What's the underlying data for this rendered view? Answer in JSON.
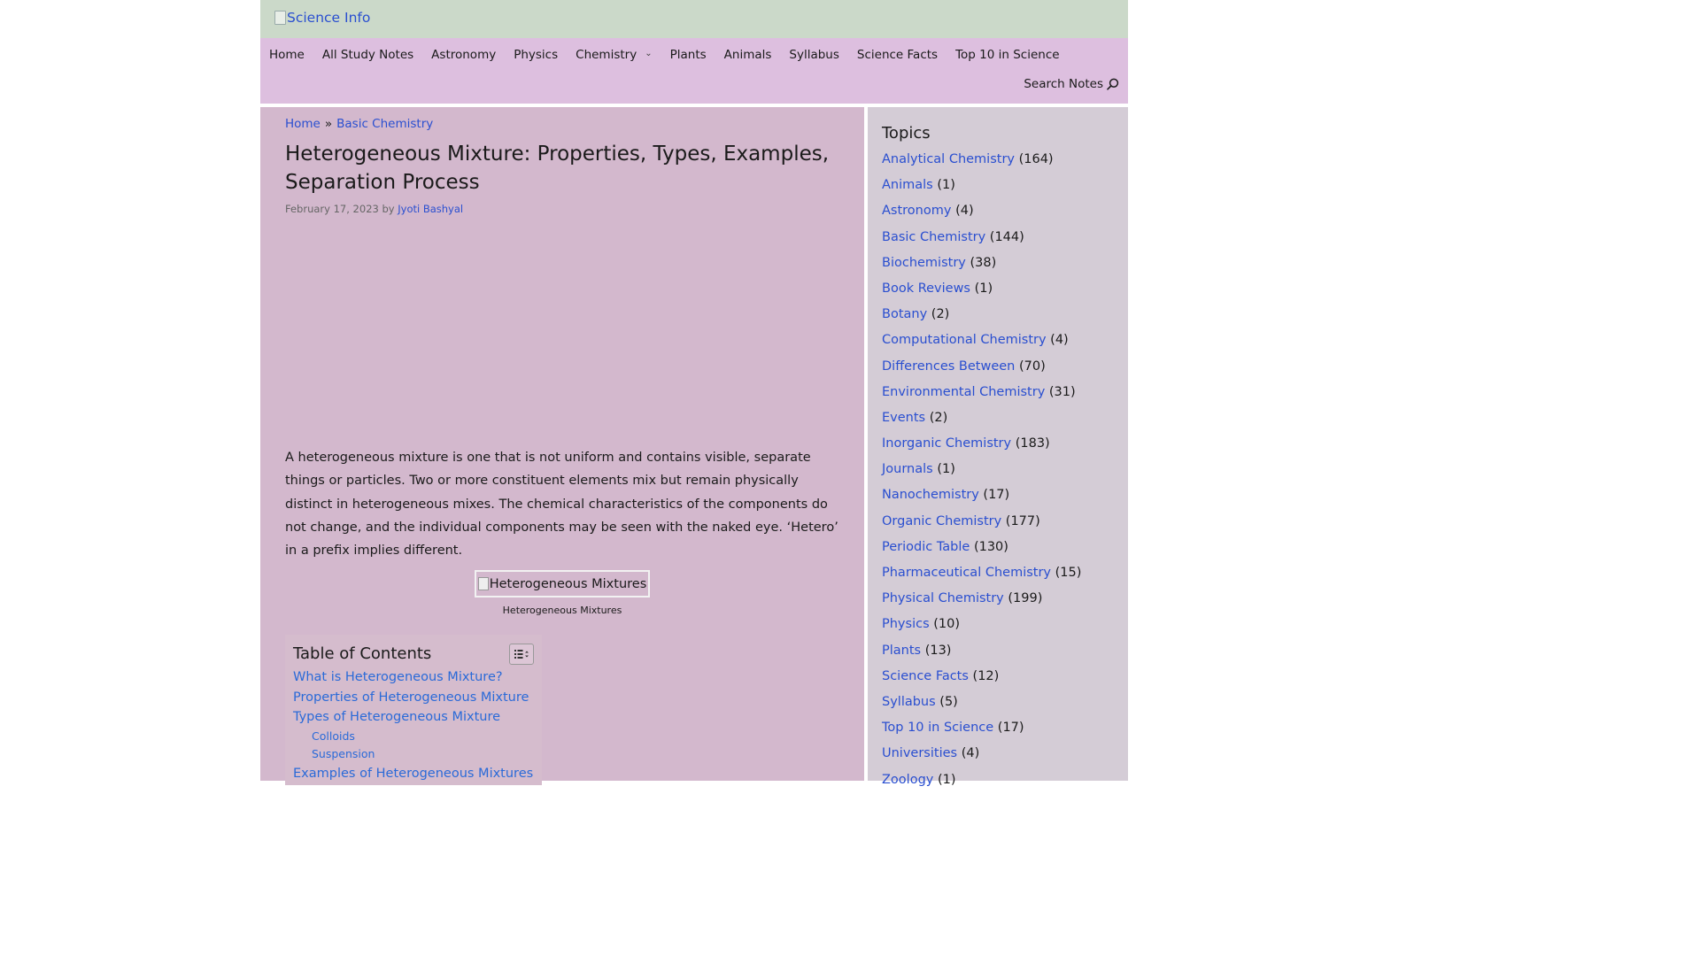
{
  "site": {
    "logo_text": "Science Info"
  },
  "nav": {
    "items": [
      "Home",
      "All Study Notes",
      "Astronomy",
      "Physics",
      "Chemistry",
      "Plants",
      "Animals",
      "Syllabus",
      "Science Facts",
      "Top 10 in Science"
    ],
    "search_label": "Search Notes"
  },
  "breadcrumb": {
    "home": "Home",
    "separator": "»",
    "category": "Basic Chemistry"
  },
  "article": {
    "title": "Heterogeneous Mixture: Properties, Types, Examples, Separation Process",
    "date": "February 17, 2023",
    "by": "by",
    "author": "Jyoti Bashyal",
    "intro": "A heterogeneous mixture is one that is not uniform and contains visible, separate things or particles. Two or more constituent elements mix but remain physically distinct in heterogeneous mixes. The chemical characteristics of the components do not change, and the individual components may be seen with the naked eye. ‘Hetero’ in a prefix implies different.",
    "figure_alt": "Heterogeneous Mixtures",
    "figure_caption": "Heterogeneous Mixtures"
  },
  "toc": {
    "title": "Table of Contents",
    "items": [
      {
        "label": "What is Heterogeneous Mixture?",
        "level": 1
      },
      {
        "label": "Properties of Heterogeneous Mixture",
        "level": 1
      },
      {
        "label": "Types of Heterogeneous Mixture",
        "level": 1
      },
      {
        "label": "Colloids",
        "level": 2
      },
      {
        "label": "Suspension",
        "level": 2
      },
      {
        "label": "Examples of Heterogeneous Mixtures",
        "level": 1
      }
    ]
  },
  "sidebar": {
    "title": "Topics",
    "topics": [
      {
        "name": "Analytical Chemistry",
        "count": "(164)"
      },
      {
        "name": "Animals",
        "count": "(1)"
      },
      {
        "name": "Astronomy",
        "count": "(4)"
      },
      {
        "name": "Basic Chemistry",
        "count": "(144)"
      },
      {
        "name": "Biochemistry",
        "count": "(38)"
      },
      {
        "name": "Book Reviews",
        "count": "(1)"
      },
      {
        "name": "Botany",
        "count": "(2)"
      },
      {
        "name": "Computational Chemistry",
        "count": "(4)"
      },
      {
        "name": "Differences Between",
        "count": "(70)"
      },
      {
        "name": "Environmental Chemistry",
        "count": "(31)"
      },
      {
        "name": "Events",
        "count": "(2)"
      },
      {
        "name": "Inorganic Chemistry",
        "count": "(183)"
      },
      {
        "name": "Journals",
        "count": "(1)"
      },
      {
        "name": "Nanochemistry",
        "count": "(17)"
      },
      {
        "name": "Organic Chemistry",
        "count": "(177)"
      },
      {
        "name": "Periodic Table",
        "count": "(130)"
      },
      {
        "name": "Pharmaceutical Chemistry",
        "count": "(15)"
      },
      {
        "name": "Physical Chemistry",
        "count": "(199)"
      },
      {
        "name": "Physics",
        "count": "(10)"
      },
      {
        "name": "Plants",
        "count": "(13)"
      },
      {
        "name": "Science Facts",
        "count": "(12)"
      },
      {
        "name": "Syllabus",
        "count": "(5)"
      },
      {
        "name": "Top 10 in Science",
        "count": "(17)"
      },
      {
        "name": "Universities",
        "count": "(4)"
      },
      {
        "name": "Zoology",
        "count": "(1)"
      }
    ]
  },
  "colors": {
    "header_bg": "#cbd9c9",
    "nav_bg": "#ddbfdf",
    "content_bg": "#d3b8cd",
    "sidebar_bg": "#d4ccd6",
    "link": "#2a4fd0"
  },
  "icons": {
    "search": "search-icon",
    "toc_toggle": "list-icon",
    "nav_dropdown": "chevron-down-icon"
  }
}
